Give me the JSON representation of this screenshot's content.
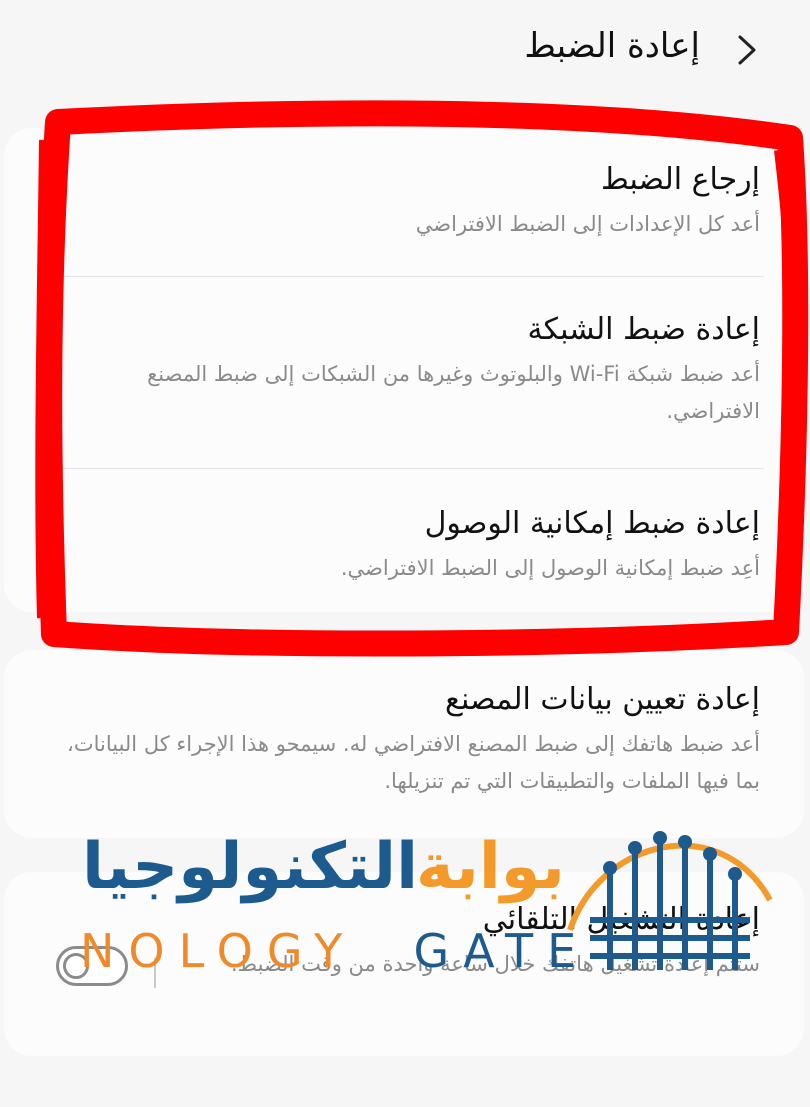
{
  "header": {
    "title": "إعادة الضبط"
  },
  "card1": {
    "items": [
      {
        "title": "إرجاع الضبط",
        "subtitle": "أعد كل الإعدادات إلى الضبط الافتراضي"
      },
      {
        "title": "إعادة ضبط الشبكة",
        "subtitle": "أعد ضبط شبكة Wi-Fi والبلوتوث وغيرها من الشبكات إلى ضبط المصنع الافتراضي."
      },
      {
        "title": "إعادة ضبط إمكانية الوصول",
        "subtitle": "أعِد ضبط إمكانية الوصول إلى الضبط الافتراضي."
      }
    ]
  },
  "card2": {
    "title": "إعادة تعيين بيانات المصنع",
    "subtitle": "أعد ضبط هاتفك إلى ضبط المصنع الافتراضي له. سيمحو هذا الإجراء كل البيانات، بما فيها الملفات والتطبيقات التي تم تنزيلها."
  },
  "card3": {
    "title": "إعادة التشغيل التلقائي",
    "subtitle": "ستتم إعادة تشغيل هاتفك خلال ساعة واحدة من وقت الضبط.",
    "toggle_on": false
  },
  "watermark": {
    "arabic_part1": "بوابة",
    "arabic_part2": "التكنولوجيا",
    "english_part1": "NOLOGY",
    "english_part2": "GATE"
  },
  "colors": {
    "highlight": "#ff0000",
    "watermark_blue": "#1d5b8f",
    "watermark_orange": "#f39a2a"
  },
  "icons": {
    "back": "chevron-right-icon",
    "toggle": "toggle-switch-icon"
  }
}
